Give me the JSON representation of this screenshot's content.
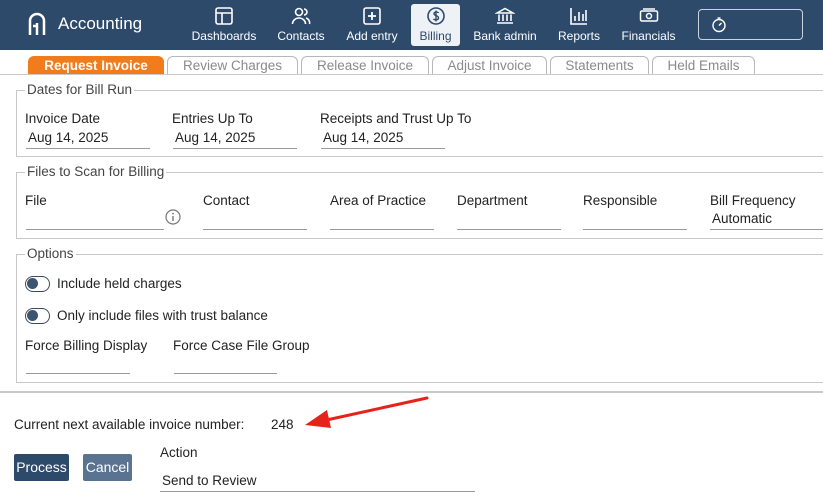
{
  "app": {
    "title": "Accounting"
  },
  "nav": {
    "dashboards": "Dashboards",
    "contacts": "Contacts",
    "add_entry": "Add entry",
    "billing": "Billing",
    "bank_admin": "Bank admin",
    "reports": "Reports",
    "financials": "Financials"
  },
  "tabs": {
    "request_invoice": "Request Invoice",
    "review_charges": "Review Charges",
    "release_invoice": "Release Invoice",
    "adjust_invoice": "Adjust Invoice",
    "statements": "Statements",
    "held_emails": "Held Emails"
  },
  "dates": {
    "legend": "Dates for Bill Run",
    "invoice_date_label": "Invoice Date",
    "invoice_date": "Aug 14, 2025",
    "entries_up_to_label": "Entries Up To",
    "entries_up_to": "Aug 14, 2025",
    "receipts_label": "Receipts and Trust Up To",
    "receipts": "Aug 14, 2025"
  },
  "files": {
    "legend": "Files to Scan for Billing",
    "file_label": "File",
    "contact_label": "Contact",
    "area_label": "Area of Practice",
    "department_label": "Department",
    "responsible_label": "Responsible",
    "frequency_label": "Bill Frequency",
    "frequency": "Automatic"
  },
  "options": {
    "legend": "Options",
    "held_charges": "Include held charges",
    "trust_balance": "Only include files with trust balance",
    "force_display_label": "Force Billing Display",
    "force_group_label": "Force Case File Group"
  },
  "footer": {
    "invoice_number_label": "Current next available invoice number:",
    "invoice_number": "248",
    "process": "Process",
    "cancel": "Cancel",
    "action_label": "Action",
    "action": "Send to Review"
  },
  "colors": {
    "nav_bg": "#2e4a6b",
    "active_tab": "#f07c1c",
    "annotation_arrow": "#e5231b"
  }
}
